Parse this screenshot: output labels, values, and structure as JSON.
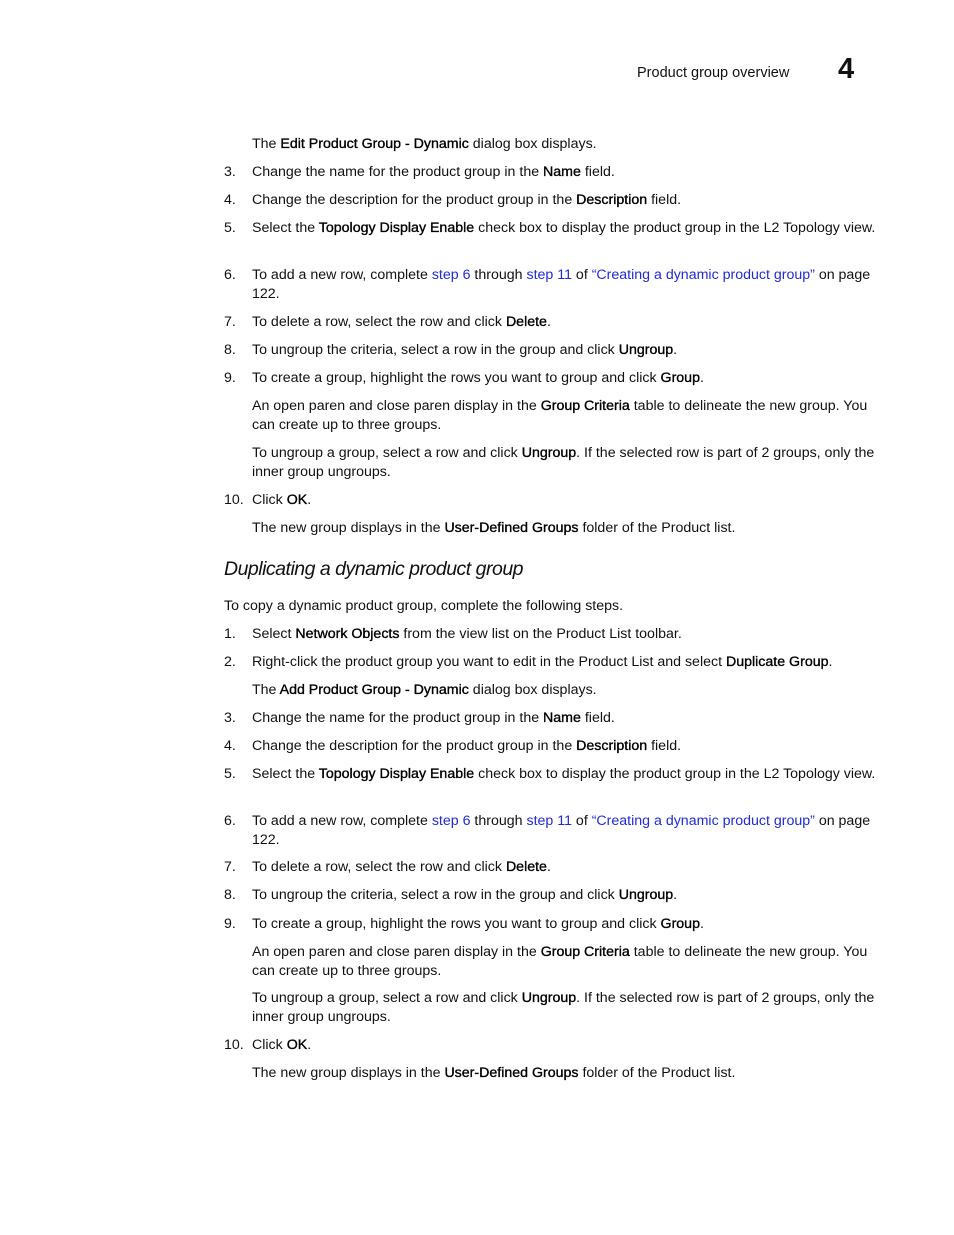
{
  "header": {
    "title": "Product group overview",
    "chapter": "4"
  },
  "section1": {
    "dialog_line": [
      "The ",
      "Edit Product Group - Dynamic",
      " dialog box displays."
    ],
    "steps": [
      {
        "num": "3.",
        "parts": [
          "Change the name for the product group in the ",
          "Name",
          " field."
        ]
      },
      {
        "num": "4.",
        "parts": [
          "Change the description for the product group in the ",
          "Description",
          " field."
        ]
      },
      {
        "num": "5.",
        "parts": [
          "Select the ",
          "Topology Display Enable",
          " check box to display the product group in the L2 Topology view."
        ]
      },
      {
        "num": "6.",
        "pre": "To add a new row, complete ",
        "link1": "step 6",
        "mid1": " through ",
        "link2": "step 11",
        "mid2": " of ",
        "link3": "“Creating a dynamic product group”",
        "post": " on page 122."
      },
      {
        "num": "7.",
        "parts": [
          "To delete a row, select the row and click ",
          "Delete",
          "."
        ]
      },
      {
        "num": "8.",
        "parts": [
          "To ungroup the criteria, select a row in the group and click ",
          "Ungroup",
          "."
        ]
      },
      {
        "num": "9.",
        "parts": [
          "To create a group, highlight the rows you want to group and click ",
          "Group",
          "."
        ]
      }
    ],
    "note1": [
      "An open paren and close paren display in the ",
      "Group Criteria",
      " table to delineate the new group. You can create up to three groups."
    ],
    "note2": [
      "To ungroup a group, select a row and click ",
      "Ungroup",
      ". If the selected row is part of 2 groups, only the inner group ungroups."
    ],
    "step10": {
      "num": "10.",
      "parts": [
        "Click ",
        "OK",
        "."
      ]
    },
    "result": [
      "The new group displays in the ",
      "User-Defined Groups",
      " folder of the Product list."
    ]
  },
  "section2": {
    "heading": "Duplicating a dynamic product group",
    "intro": "To copy a dynamic product group, complete the following steps.",
    "step1": {
      "num": "1.",
      "parts": [
        "Select ",
        "Network Objects",
        " from the view list on the Product List toolbar."
      ]
    },
    "step2": {
      "num": "2.",
      "parts": [
        "Right-click the product group you want to edit in the Product List and select ",
        "Duplicate Group",
        "."
      ]
    },
    "dialog_line": [
      "The ",
      "Add Product Group - Dynamic",
      " dialog box displays."
    ]
  }
}
